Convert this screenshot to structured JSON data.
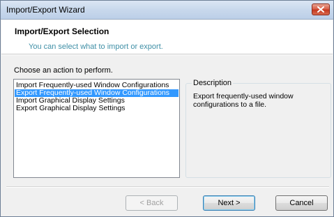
{
  "window": {
    "title": "Import/Export Wizard"
  },
  "header": {
    "title": "Import/Export Selection",
    "subtitle": "You can select what to import or export."
  },
  "prompt": "Choose an action to perform.",
  "actions": [
    {
      "label": "Import Frequently-used Window Configurations",
      "selected": false
    },
    {
      "label": "Export Frequently-used Window Configurations",
      "selected": true
    },
    {
      "label": "Import Graphical Display Settings",
      "selected": false
    },
    {
      "label": "Export Graphical Display Settings",
      "selected": false
    }
  ],
  "description": {
    "legend": "Description",
    "text": "Export frequently-used window configurations to a file."
  },
  "buttons": {
    "back": "< Back",
    "next": "Next >",
    "cancel": "Cancel"
  },
  "colors": {
    "selection": "#3399ff",
    "subtitle": "#3f8fa6",
    "close_button": "#c5391f"
  }
}
